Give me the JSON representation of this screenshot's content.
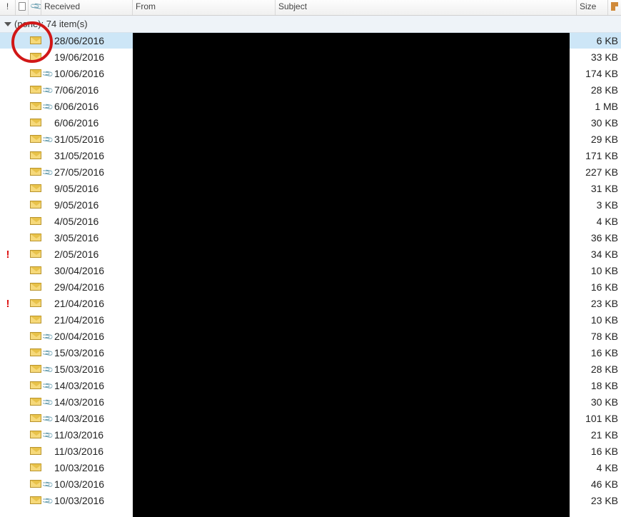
{
  "header": {
    "importance_label": "!",
    "received_label": "Received",
    "from_label": "From",
    "subject_label": "Subject",
    "size_label": "Size"
  },
  "group": {
    "label": "(none): 74 item(s)"
  },
  "rows": [
    {
      "importance": "",
      "attach": false,
      "date": "28/06/2016",
      "size": "6 KB",
      "selected": true,
      "ellipsis": false
    },
    {
      "importance": "",
      "attach": false,
      "date": "19/06/2016",
      "size": "33 KB",
      "selected": false,
      "ellipsis": false
    },
    {
      "importance": "",
      "attach": true,
      "date": "10/06/2016",
      "size": "174 KB",
      "selected": false,
      "ellipsis": false
    },
    {
      "importance": "",
      "attach": true,
      "date": "7/06/2016",
      "size": "28 KB",
      "selected": false,
      "ellipsis": false
    },
    {
      "importance": "",
      "attach": true,
      "date": "6/06/2016",
      "size": "1 MB",
      "selected": false,
      "ellipsis": true
    },
    {
      "importance": "",
      "attach": false,
      "date": "6/06/2016",
      "size": "30 KB",
      "selected": false,
      "ellipsis": false
    },
    {
      "importance": "",
      "attach": true,
      "date": "31/05/2016",
      "size": "29 KB",
      "selected": false,
      "ellipsis": false
    },
    {
      "importance": "",
      "attach": false,
      "date": "31/05/2016",
      "size": "171 KB",
      "selected": false,
      "ellipsis": false
    },
    {
      "importance": "",
      "attach": true,
      "date": "27/05/2016",
      "size": "227 KB",
      "selected": false,
      "ellipsis": false
    },
    {
      "importance": "",
      "attach": false,
      "date": "9/05/2016",
      "size": "31 KB",
      "selected": false,
      "ellipsis": false
    },
    {
      "importance": "",
      "attach": false,
      "date": "9/05/2016",
      "size": "3 KB",
      "selected": false,
      "ellipsis": false
    },
    {
      "importance": "",
      "attach": false,
      "date": "4/05/2016",
      "size": "4 KB",
      "selected": false,
      "ellipsis": false
    },
    {
      "importance": "",
      "attach": false,
      "date": "3/05/2016",
      "size": "36 KB",
      "selected": false,
      "ellipsis": false
    },
    {
      "importance": "!",
      "attach": false,
      "date": "2/05/2016",
      "size": "34 KB",
      "selected": false,
      "ellipsis": false
    },
    {
      "importance": "",
      "attach": false,
      "date": "30/04/2016",
      "size": "10 KB",
      "selected": false,
      "ellipsis": false
    },
    {
      "importance": "",
      "attach": false,
      "date": "29/04/2016",
      "size": "16 KB",
      "selected": false,
      "ellipsis": false
    },
    {
      "importance": "!",
      "attach": false,
      "date": "21/04/2016",
      "size": "23 KB",
      "selected": false,
      "ellipsis": false
    },
    {
      "importance": "",
      "attach": false,
      "date": "21/04/2016",
      "size": "10 KB",
      "selected": false,
      "ellipsis": false
    },
    {
      "importance": "",
      "attach": true,
      "date": "20/04/2016",
      "size": "78 KB",
      "selected": false,
      "ellipsis": false
    },
    {
      "importance": "",
      "attach": true,
      "date": "15/03/2016",
      "size": "16 KB",
      "selected": false,
      "ellipsis": false
    },
    {
      "importance": "",
      "attach": true,
      "date": "15/03/2016",
      "size": "28 KB",
      "selected": false,
      "ellipsis": false
    },
    {
      "importance": "",
      "attach": true,
      "date": "14/03/2016",
      "size": "18 KB",
      "selected": false,
      "ellipsis": false
    },
    {
      "importance": "",
      "attach": true,
      "date": "14/03/2016",
      "size": "30 KB",
      "selected": false,
      "ellipsis": false
    },
    {
      "importance": "",
      "attach": true,
      "date": "14/03/2016",
      "size": "101 KB",
      "selected": false,
      "ellipsis": false
    },
    {
      "importance": "",
      "attach": true,
      "date": "11/03/2016",
      "size": "21 KB",
      "selected": false,
      "ellipsis": false
    },
    {
      "importance": "",
      "attach": false,
      "date": "11/03/2016",
      "size": "16 KB",
      "selected": false,
      "ellipsis": false
    },
    {
      "importance": "",
      "attach": false,
      "date": "10/03/2016",
      "size": "4 KB",
      "selected": false,
      "ellipsis": false
    },
    {
      "importance": "",
      "attach": true,
      "date": "10/03/2016",
      "size": "46 KB",
      "selected": false,
      "ellipsis": false
    },
    {
      "importance": "",
      "attach": true,
      "date": "10/03/2016",
      "size": "23 KB",
      "selected": false,
      "ellipsis": false
    }
  ]
}
